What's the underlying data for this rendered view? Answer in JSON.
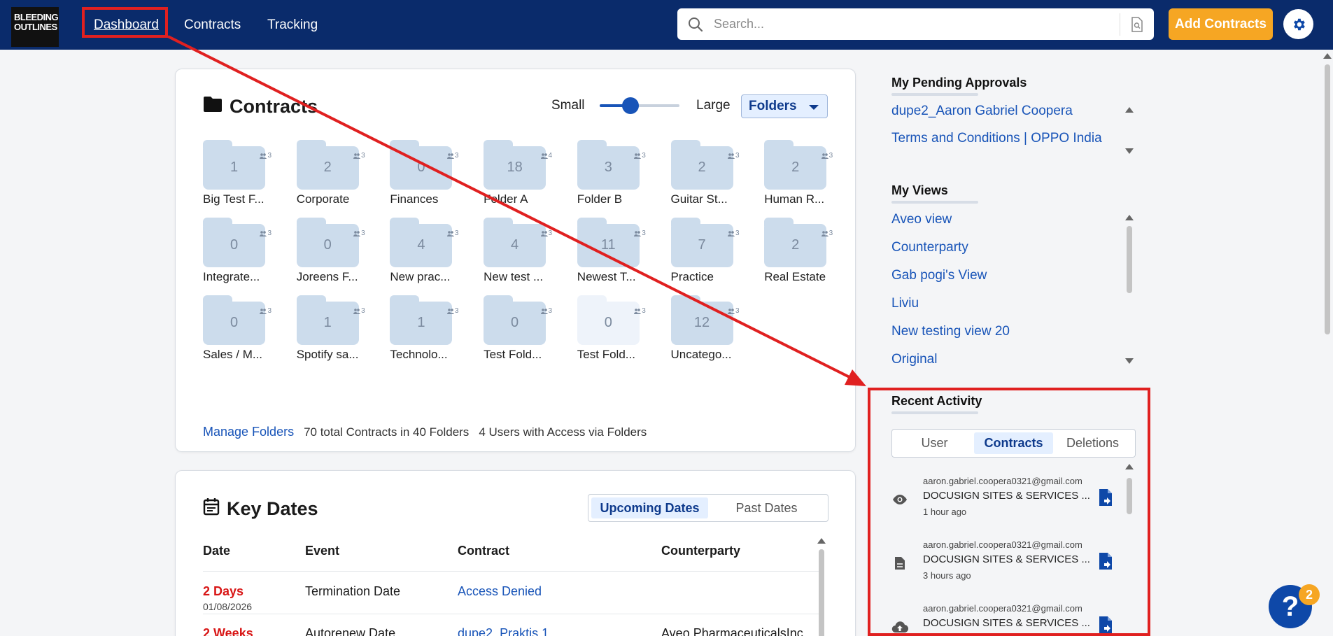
{
  "nav": {
    "logo_line1": "BLEEDING",
    "logo_line2": "OUTLINES",
    "dashboard": "Dashboard",
    "contracts": "Contracts",
    "tracking": "Tracking"
  },
  "search": {
    "placeholder": "Search..."
  },
  "header": {
    "add_contracts": "Add Contracts"
  },
  "contracts_card": {
    "title": "Contracts",
    "size_small": "Small",
    "size_large": "Large",
    "view_mode": "Folders",
    "slider_value_percent": 32,
    "folders": [
      {
        "count": "1",
        "users": "3",
        "name": "Big Test F..."
      },
      {
        "count": "2",
        "users": "3",
        "name": "Corporate"
      },
      {
        "count": "0",
        "users": "3",
        "name": "Finances"
      },
      {
        "count": "18",
        "users": "4",
        "name": "Folder A"
      },
      {
        "count": "3",
        "users": "3",
        "name": "Folder B"
      },
      {
        "count": "2",
        "users": "3",
        "name": "Guitar St..."
      },
      {
        "count": "2",
        "users": "3",
        "name": "Human R..."
      },
      {
        "count": "0",
        "users": "3",
        "name": "Integrate..."
      },
      {
        "count": "0",
        "users": "3",
        "name": "Joreens F..."
      },
      {
        "count": "4",
        "users": "3",
        "name": "New prac..."
      },
      {
        "count": "4",
        "users": "3",
        "name": "New test ..."
      },
      {
        "count": "11",
        "users": "3",
        "name": "Newest T..."
      },
      {
        "count": "7",
        "users": "3",
        "name": "Practice"
      },
      {
        "count": "2",
        "users": "3",
        "name": "Real Estate"
      },
      {
        "count": "0",
        "users": "3",
        "name": "Sales / M..."
      },
      {
        "count": "1",
        "users": "3",
        "name": "Spotify sa..."
      },
      {
        "count": "1",
        "users": "3",
        "name": "Technolo..."
      },
      {
        "count": "0",
        "users": "3",
        "name": "Test Fold..."
      },
      {
        "count": "0",
        "users": "3",
        "name": "Test Fold..."
      },
      {
        "count": "12",
        "users": "3",
        "name": "Uncatego..."
      }
    ],
    "manage_folders": "Manage Folders",
    "total_summary": "70 total Contracts in 40 Folders",
    "users_summary": "4 Users with Access via Folders"
  },
  "key_dates": {
    "title": "Key Dates",
    "tab_upcoming": "Upcoming Dates",
    "tab_past": "Past Dates",
    "columns": [
      "Date",
      "Event",
      "Contract",
      "Counterparty"
    ],
    "rows": [
      {
        "date": "2 Days",
        "date_sub": "01/08/2026",
        "event": "Termination Date",
        "contract": "Access Denied",
        "counterparty": ""
      },
      {
        "date": "2 Weeks",
        "date_sub": "",
        "event": "Autorenew Date",
        "contract": "dupe2_Praktis 1",
        "counterparty": "Aveo PharmaceuticalsInc"
      }
    ]
  },
  "pending": {
    "title": "My Pending Approvals",
    "items": [
      "dupe2_Aaron Gabriel Coopera",
      "Terms and Conditions | OPPO India"
    ]
  },
  "views": {
    "title": "My Views",
    "items": [
      "Aveo view",
      "Counterparty",
      "Gab pogi's View",
      "Liviu",
      "New testing view 20",
      "Original"
    ]
  },
  "recent": {
    "title": "Recent Activity",
    "tab_user": "User",
    "tab_contracts": "Contracts",
    "tab_deletions": "Deletions",
    "items": [
      {
        "email": "aaron.gabriel.coopera0321@gmail.com",
        "title": "DOCUSIGN SITES & SERVICES ...",
        "time": "1 hour ago",
        "icon": "eye-icon"
      },
      {
        "email": "aaron.gabriel.coopera0321@gmail.com",
        "title": "DOCUSIGN SITES & SERVICES ...",
        "time": "3 hours ago",
        "icon": "document-icon"
      },
      {
        "email": "aaron.gabriel.coopera0321@gmail.com",
        "title": "DOCUSIGN SITES & SERVICES ...",
        "time": "",
        "icon": "upload-icon"
      }
    ]
  },
  "help": {
    "glyph": "?",
    "badge": "2"
  },
  "colors": {
    "nav_bg": "#0a2b6b",
    "accent_orange": "#f6a623",
    "link_blue": "#1854b8",
    "annotation_red": "#e02020",
    "due_red": "#d81616"
  }
}
